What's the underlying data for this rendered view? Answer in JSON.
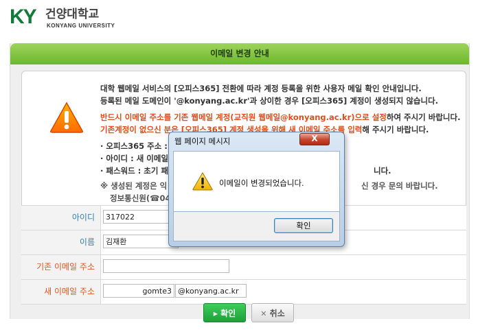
{
  "header": {
    "logo_mark": "KY",
    "logo_korean": "건양대학교",
    "logo_english": "KONYANG UNIVERSITY"
  },
  "panel": {
    "title": "이메일 변경 안내",
    "line1": "대학 웹메일 서비스의 [오피스365] 전환에 따라 계정 등록을 위한 사용자 메일 확인 안내입니다.",
    "line2": "등록된 메일 도메인이 '@konyang.ac.kr'과 상이한 경우 [오피스365] 계정이 생성되지 않습니다.",
    "line3_red": "반드시 이메일 주소를 기존 웹메일 계정(교직원 웹메일@konyang.ac.kr)으로 설정",
    "line3_tail": "하여 주시기 바랍니다.",
    "line4_red": "기존계정이 없으신 분은 [오피스365] 계정 생성을 위해 새 이메일 주소를 입력",
    "line4_tail": "해 주시기 바랍니다.",
    "bullet1": "· 오피스365 주소 : h",
    "bullet2": "· 아이디 : 새 이메일",
    "bullet3": "· 패스워드 : 초기 패",
    "bullet3_tail": "니다.",
    "note1": "※ 생성된 계정은 익",
    "note1_tail": "신 경우 문의 바랍니다.",
    "note2": "정보통신원(☎04"
  },
  "form": {
    "id_label": "아이디",
    "id_value": "317022",
    "name_label": "이름",
    "name_value": "김재환",
    "old_email_label": "기존 이메일 주소",
    "old_email_value": "",
    "new_email_label": "새 이메일 주소",
    "new_email_user": "gomte3",
    "new_email_domain": "@konyang.ac.kr"
  },
  "buttons": {
    "confirm": "확인",
    "cancel": "취소"
  },
  "dialog": {
    "title": "웹 페이지 메시지",
    "close": "X",
    "message": "이메일이 변경되었습니다.",
    "ok": "확인"
  }
}
